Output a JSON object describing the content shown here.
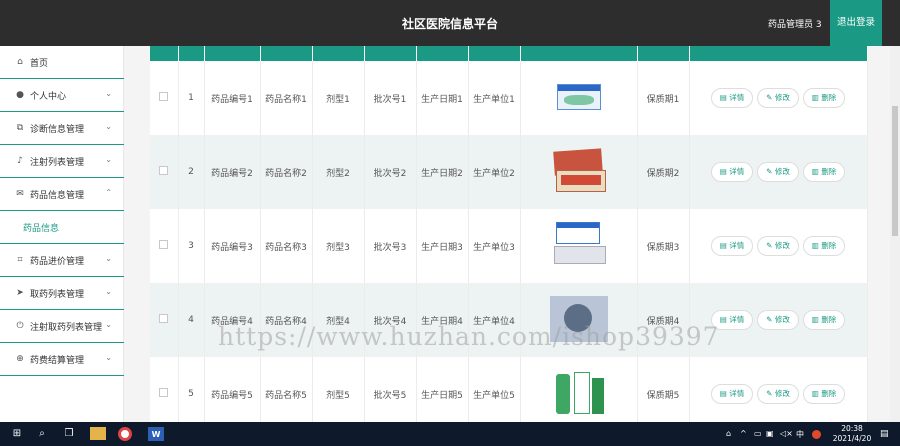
{
  "header": {
    "title": "社区医院信息平台",
    "user_label": "药品管理员 3",
    "logout_label": "退出登录"
  },
  "sidebar": {
    "items": [
      {
        "label": "首页",
        "icon": "home-icon"
      },
      {
        "label": "个人中心",
        "icon": "user-icon"
      },
      {
        "label": "诊断信息管理",
        "icon": "copy-icon"
      },
      {
        "label": "注射列表管理",
        "icon": "microphone-icon"
      },
      {
        "label": "药品信息管理",
        "icon": "mail-icon"
      },
      {
        "label": "药品进价管理",
        "icon": "crop-icon"
      },
      {
        "label": "取药列表管理",
        "icon": "send-icon"
      },
      {
        "label": "注射取药列表管理",
        "icon": "power-icon"
      },
      {
        "label": "药费结算管理",
        "icon": "globe-icon"
      }
    ],
    "sub_item": "药品信息"
  },
  "table": {
    "rows": [
      {
        "index": "1",
        "code": "药品编号1",
        "name": "药品名称1",
        "form": "剂型1",
        "batch": "批次号1",
        "date": "生产日期1",
        "maker": "生产单位1",
        "expiry": "保质期1"
      },
      {
        "index": "2",
        "code": "药品编号2",
        "name": "药品名称2",
        "form": "剂型2",
        "batch": "批次号2",
        "date": "生产日期2",
        "maker": "生产单位2",
        "expiry": "保质期2"
      },
      {
        "index": "3",
        "code": "药品编号3",
        "name": "药品名称3",
        "form": "剂型3",
        "batch": "批次号3",
        "date": "生产日期3",
        "maker": "生产单位3",
        "expiry": "保质期3"
      },
      {
        "index": "4",
        "code": "药品编号4",
        "name": "药品名称4",
        "form": "剂型4",
        "batch": "批次号4",
        "date": "生产日期4",
        "maker": "生产单位4",
        "expiry": "保质期4"
      },
      {
        "index": "5",
        "code": "药品编号5",
        "name": "药品名称5",
        "form": "剂型5",
        "batch": "批次号5",
        "date": "生产日期5",
        "maker": "生产单位5",
        "expiry": "保质期5"
      }
    ],
    "actions": {
      "detail": "详情",
      "edit": "修改",
      "delete": "删除"
    }
  },
  "taskbar": {
    "tray_lang": "中",
    "time": "20:38",
    "date": "2021/4/20"
  },
  "watermark": "https://www.huzhan.com/ishop39397",
  "colors": {
    "accent": "#1a9a84",
    "topbar": "#2d2d2d",
    "taskbar": "#0e1a2b"
  }
}
